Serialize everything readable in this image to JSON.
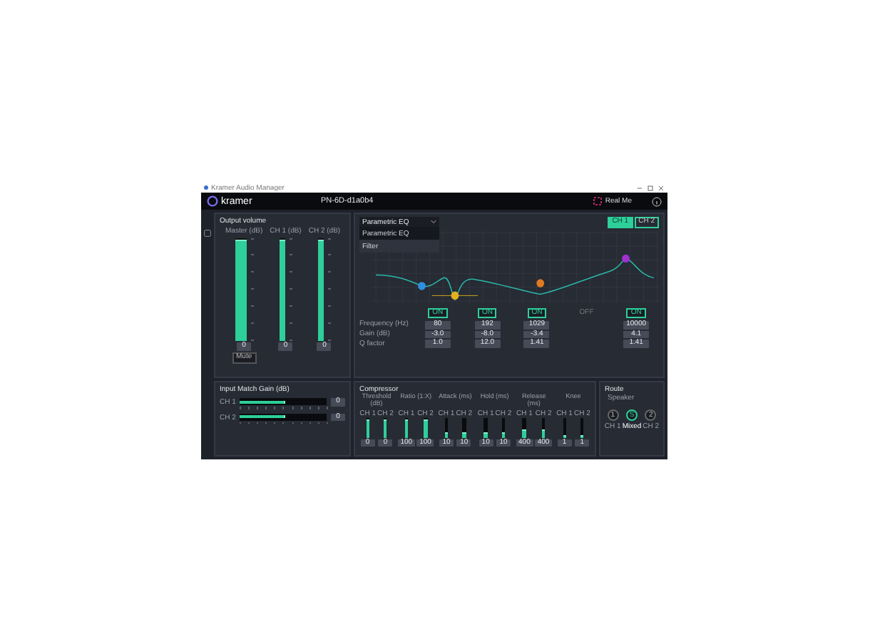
{
  "window": {
    "title": "Kramer Audio Manager"
  },
  "header": {
    "logo": "kramer",
    "device": "PN-6D-d1a0b4",
    "identify": "Real Me"
  },
  "output_volume": {
    "title": "Output volume",
    "mute": "Mute",
    "channels": [
      {
        "name": "Master (dB)",
        "level": 0.97,
        "value": "0"
      },
      {
        "name": "CH 1 (dB)",
        "level": 0.97,
        "value": "0"
      },
      {
        "name": "CH 2 (dB)",
        "level": 0.97,
        "value": "0"
      }
    ]
  },
  "eq": {
    "mode": "Parametric EQ",
    "options": [
      {
        "label": "Parametric EQ",
        "selected": true
      },
      {
        "label": "Filter",
        "selected": false
      }
    ],
    "channel_tabs": [
      {
        "label": "CH 1",
        "selected": true
      },
      {
        "label": "CH 2",
        "selected": false
      }
    ],
    "rows": [
      "Frequency (Hz)",
      "Gain (dB)",
      "Q factor"
    ],
    "bands": [
      {
        "on": true,
        "toggle": "ON",
        "color": "#2f8fe0",
        "values": [
          "80",
          "-3.0",
          "1.0"
        ]
      },
      {
        "on": true,
        "toggle": "ON",
        "color": "#e0b020",
        "values": [
          "192",
          "-8.0",
          "12.0"
        ]
      },
      {
        "on": true,
        "toggle": "ON",
        "color": "#e07a20",
        "values": [
          "1029",
          "-3.4",
          "1.41"
        ]
      },
      {
        "on": false,
        "toggle": "OFF"
      },
      {
        "on": true,
        "toggle": "ON",
        "color": "#a030d0",
        "values": [
          "10000",
          "4.1",
          "1.41"
        ]
      }
    ]
  },
  "input_gain": {
    "title": "Input Match Gain (dB)",
    "channels": [
      {
        "name": "CH 1",
        "level": 0.5,
        "value": "0"
      },
      {
        "name": "CH 2",
        "level": 0.5,
        "value": "0"
      }
    ]
  },
  "compressor": {
    "title": "Compressor",
    "params": [
      {
        "label": "Threshold (dB)",
        "channels": [
          {
            "name": "CH 1",
            "level": 0.85,
            "value": "0"
          },
          {
            "name": "CH 2",
            "level": 0.85,
            "value": "0"
          }
        ]
      },
      {
        "label": "Ratio (1:X)",
        "channels": [
          {
            "name": "CH 1",
            "level": 0.85,
            "value": "100"
          },
          {
            "name": "CH 2",
            "level": 0.85,
            "value": "100"
          }
        ]
      },
      {
        "label": "Attack (ms)",
        "channels": [
          {
            "name": "CH 1",
            "level": 0.2,
            "value": "10"
          },
          {
            "name": "CH 2",
            "level": 0.2,
            "value": "10"
          }
        ]
      },
      {
        "label": "Hold (ms)",
        "channels": [
          {
            "name": "CH 1",
            "level": 0.2,
            "value": "10"
          },
          {
            "name": "CH 2",
            "level": 0.2,
            "value": "10"
          }
        ]
      },
      {
        "label": "Release (ms)",
        "channels": [
          {
            "name": "CH 1",
            "level": 0.35,
            "value": "400"
          },
          {
            "name": "CH 2",
            "level": 0.35,
            "value": "400"
          }
        ]
      },
      {
        "label": "Knee",
        "channels": [
          {
            "name": "CH 1",
            "level": 0.08,
            "value": "1"
          },
          {
            "name": "CH 2",
            "level": 0.08,
            "value": "1"
          }
        ]
      }
    ]
  },
  "route": {
    "title": "Route",
    "target": "Speaker",
    "options": [
      {
        "glyph": "1",
        "label": "CH 1",
        "selected": false
      },
      {
        "glyph": "S",
        "label": "Mixed",
        "selected": true
      },
      {
        "glyph": "2",
        "label": "CH 2",
        "selected": false
      }
    ]
  }
}
